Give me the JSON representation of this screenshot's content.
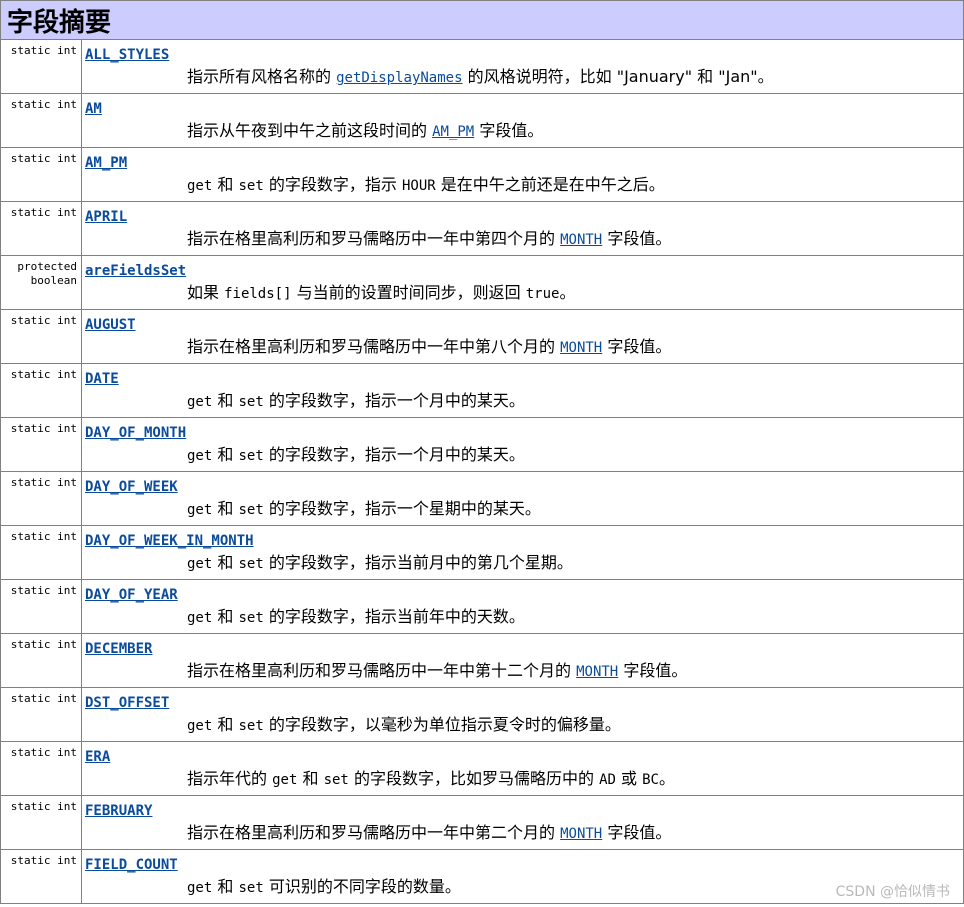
{
  "title": "字段摘要",
  "rows": [
    {
      "modifier": "static int",
      "name": "ALL_STYLES",
      "desc": [
        [
          "t",
          "指示所有风格名称的 "
        ],
        [
          "l",
          "getDisplayNames"
        ],
        [
          "t",
          " 的风格说明符，比如 \"January\" 和 \"Jan\"。"
        ]
      ]
    },
    {
      "modifier": "static int",
      "name": "AM",
      "desc": [
        [
          "t",
          "指示从午夜到中午之前这段时间的 "
        ],
        [
          "l",
          "AM_PM"
        ],
        [
          "t",
          " 字段值。"
        ]
      ]
    },
    {
      "modifier": "static int",
      "name": "AM_PM",
      "desc": [
        [
          "c",
          "get"
        ],
        [
          "t",
          " 和 "
        ],
        [
          "c",
          "set"
        ],
        [
          "t",
          " 的字段数字，指示 "
        ],
        [
          "c",
          "HOUR"
        ],
        [
          "t",
          " 是在中午之前还是在中午之后。"
        ]
      ]
    },
    {
      "modifier": "static int",
      "name": "APRIL",
      "desc": [
        [
          "t",
          "指示在格里高利历和罗马儒略历中一年中第四个月的 "
        ],
        [
          "l",
          "MONTH"
        ],
        [
          "t",
          " 字段值。"
        ]
      ]
    },
    {
      "modifier": "protected\nboolean",
      "name": "areFieldsSet",
      "desc": [
        [
          "t",
          "如果 "
        ],
        [
          "c",
          "fields[]"
        ],
        [
          "t",
          " 与当前的设置时间同步，则返回 "
        ],
        [
          "c",
          "true"
        ],
        [
          "t",
          "。"
        ]
      ]
    },
    {
      "modifier": "static int",
      "name": "AUGUST",
      "desc": [
        [
          "t",
          "指示在格里高利历和罗马儒略历中一年中第八个月的 "
        ],
        [
          "l",
          "MONTH"
        ],
        [
          "t",
          " 字段值。"
        ]
      ]
    },
    {
      "modifier": "static int",
      "name": "DATE",
      "desc": [
        [
          "c",
          "get"
        ],
        [
          "t",
          " 和 "
        ],
        [
          "c",
          "set"
        ],
        [
          "t",
          " 的字段数字，指示一个月中的某天。"
        ]
      ]
    },
    {
      "modifier": "static int",
      "name": "DAY_OF_MONTH",
      "desc": [
        [
          "c",
          "get"
        ],
        [
          "t",
          " 和 "
        ],
        [
          "c",
          "set"
        ],
        [
          "t",
          " 的字段数字，指示一个月中的某天。"
        ]
      ]
    },
    {
      "modifier": "static int",
      "name": "DAY_OF_WEEK",
      "desc": [
        [
          "c",
          "get"
        ],
        [
          "t",
          " 和 "
        ],
        [
          "c",
          "set"
        ],
        [
          "t",
          " 的字段数字，指示一个星期中的某天。"
        ]
      ]
    },
    {
      "modifier": "static int",
      "name": "DAY_OF_WEEK_IN_MONTH",
      "desc": [
        [
          "c",
          "get"
        ],
        [
          "t",
          " 和 "
        ],
        [
          "c",
          "set"
        ],
        [
          "t",
          " 的字段数字，指示当前月中的第几个星期。"
        ]
      ]
    },
    {
      "modifier": "static int",
      "name": "DAY_OF_YEAR",
      "desc": [
        [
          "c",
          "get"
        ],
        [
          "t",
          " 和 "
        ],
        [
          "c",
          "set"
        ],
        [
          "t",
          " 的字段数字，指示当前年中的天数。"
        ]
      ]
    },
    {
      "modifier": "static int",
      "name": "DECEMBER",
      "desc": [
        [
          "t",
          "指示在格里高利历和罗马儒略历中一年中第十二个月的 "
        ],
        [
          "l",
          "MONTH"
        ],
        [
          "t",
          " 字段值。"
        ]
      ]
    },
    {
      "modifier": "static int",
      "name": "DST_OFFSET",
      "desc": [
        [
          "c",
          "get"
        ],
        [
          "t",
          " 和 "
        ],
        [
          "c",
          "set"
        ],
        [
          "t",
          " 的字段数字，以毫秒为单位指示夏令时的偏移量。"
        ]
      ]
    },
    {
      "modifier": "static int",
      "name": "ERA",
      "desc": [
        [
          "t",
          "指示年代的 "
        ],
        [
          "c",
          "get"
        ],
        [
          "t",
          " 和 "
        ],
        [
          "c",
          "set"
        ],
        [
          "t",
          " 的字段数字，比如罗马儒略历中的 "
        ],
        [
          "c",
          "AD"
        ],
        [
          "t",
          " 或 "
        ],
        [
          "c",
          "BC"
        ],
        [
          "t",
          "。"
        ]
      ]
    },
    {
      "modifier": "static int",
      "name": "FEBRUARY",
      "desc": [
        [
          "t",
          "指示在格里高利历和罗马儒略历中一年中第二个月的 "
        ],
        [
          "l",
          "MONTH"
        ],
        [
          "t",
          " 字段值。"
        ]
      ]
    },
    {
      "modifier": "static int",
      "name": "FIELD_COUNT",
      "desc": [
        [
          "c",
          "get"
        ],
        [
          "t",
          " 和 "
        ],
        [
          "c",
          "set"
        ],
        [
          "t",
          " 可识别的不同字段的数量。"
        ]
      ]
    }
  ],
  "watermark": "CSDN @恰似情书"
}
